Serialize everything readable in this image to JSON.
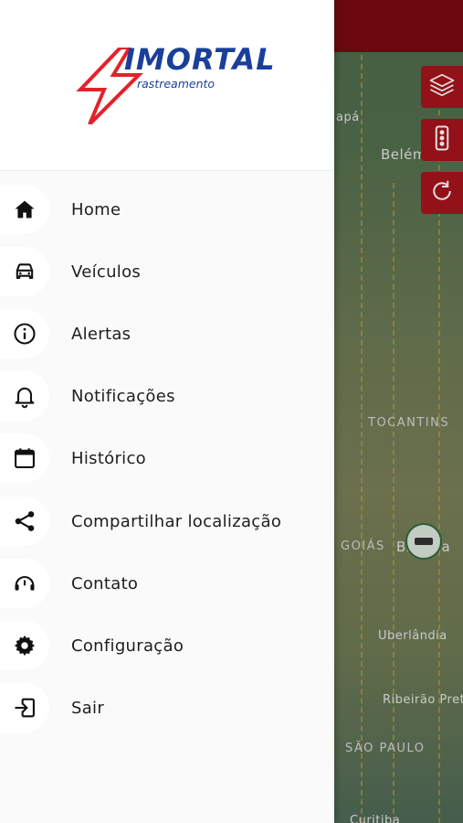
{
  "app": {
    "logo_text": "IMORTAL",
    "logo_sub": "rastreamento",
    "brand_red": "#e3222a",
    "brand_blue": "#1a3f9b"
  },
  "map": {
    "labels": {
      "apa": "apá",
      "belem": "Belém",
      "tocantins": "TOCANTINS",
      "goias": "GOIÁS",
      "brasilia": "Brasília",
      "uberlandia": "Uberlândia",
      "ribeirao": "Ribeirão Pret",
      "sao_paulo": "SÃO PAULO",
      "curitiba": "Curitiba"
    },
    "buttons": [
      "layers-icon",
      "traffic-icon",
      "refresh-icon"
    ]
  },
  "menu": {
    "items": [
      {
        "label": "Home",
        "icon": "home-icon"
      },
      {
        "label": "Veículos",
        "icon": "car-icon"
      },
      {
        "label": "Alertas",
        "icon": "info-icon"
      },
      {
        "label": "Notificações",
        "icon": "bell-icon"
      },
      {
        "label": "Histórico",
        "icon": "calendar-icon"
      },
      {
        "label": "Compartilhar localização",
        "icon": "share-icon"
      },
      {
        "label": "Contato",
        "icon": "support-icon"
      },
      {
        "label": "Configuração",
        "icon": "gear-icon"
      },
      {
        "label": "Sair",
        "icon": "logout-icon"
      }
    ]
  }
}
